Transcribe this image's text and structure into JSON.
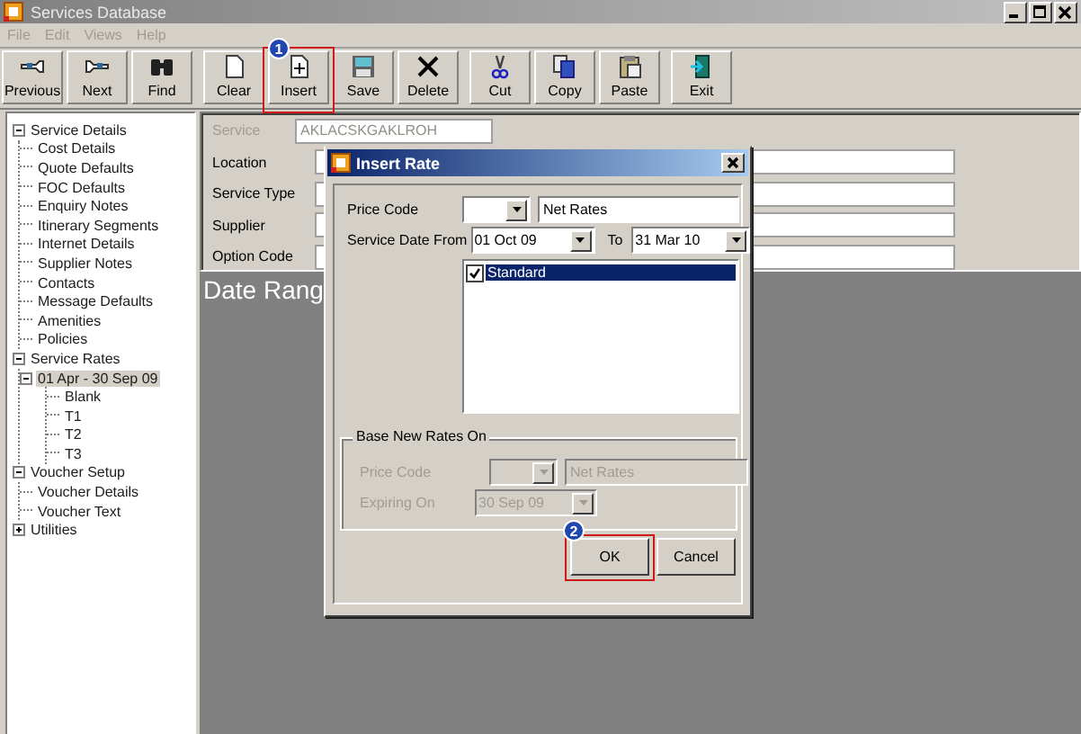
{
  "window": {
    "title": "Services Database"
  },
  "menu": [
    {
      "label": "File",
      "disabled": true
    },
    {
      "label": "Edit",
      "disabled": true
    },
    {
      "label": "Views",
      "disabled": true
    },
    {
      "label": "Help",
      "disabled": true
    }
  ],
  "toolbar": [
    [
      {
        "label": "Previous",
        "kind": "previous"
      },
      {
        "label": "Next",
        "kind": "next"
      },
      {
        "label": "Find",
        "kind": "find"
      }
    ],
    [
      {
        "label": "Clear",
        "kind": "clear"
      },
      {
        "label": "Insert",
        "kind": "insert",
        "annotation": "1"
      },
      {
        "label": "Save",
        "kind": "save"
      },
      {
        "label": "Delete",
        "kind": "delete"
      }
    ],
    [
      {
        "label": "Cut",
        "kind": "cut"
      },
      {
        "label": "Copy",
        "kind": "copy"
      },
      {
        "label": "Paste",
        "kind": "paste"
      }
    ]
  ],
  "toolbar_right": [
    {
      "label": "Exit",
      "kind": "exit"
    }
  ],
  "tree": [
    {
      "label": "Service Details",
      "expanded": true,
      "selected": false,
      "children": [
        {
          "label": "Cost Details",
          "selected": false
        },
        {
          "label": "Quote Defaults",
          "selected": false
        },
        {
          "label": "FOC Defaults",
          "selected": false
        },
        {
          "label": "Enquiry Notes",
          "selected": false
        },
        {
          "label": "Itinerary Segments",
          "selected": false
        },
        {
          "label": "Internet Details",
          "selected": false
        },
        {
          "label": "Supplier Notes",
          "selected": false
        },
        {
          "label": "Contacts",
          "selected": false
        },
        {
          "label": "Message Defaults",
          "selected": false
        },
        {
          "label": "Amenities",
          "selected": false
        },
        {
          "label": "Policies",
          "selected": false
        }
      ]
    },
    {
      "label": "Service Rates",
      "expanded": true,
      "selected": false,
      "children": [
        {
          "label": "01 Apr - 30 Sep 09",
          "expanded": true,
          "selected": true,
          "children": [
            {
              "label": "Blank",
              "selected": false
            },
            {
              "label": "T1",
              "selected": false
            },
            {
              "label": "T2",
              "selected": false
            },
            {
              "label": "T3",
              "selected": false
            }
          ]
        }
      ]
    },
    {
      "label": "Voucher Setup",
      "expanded": true,
      "selected": false,
      "children": [
        {
          "label": "Voucher Details",
          "selected": false
        },
        {
          "label": "Voucher Text",
          "selected": false
        }
      ]
    },
    {
      "label": "Utilities",
      "expanded": false,
      "selected": false
    }
  ],
  "form": {
    "fields": [
      {
        "label": "Service",
        "value": "AKLACSKGAKLROH",
        "disabled": true
      },
      {
        "label": "Location",
        "disabled": false
      },
      {
        "label": "Service Type",
        "disabled": false
      },
      {
        "label": "Supplier",
        "disabled": false
      },
      {
        "label": "Option Code",
        "disabled": false
      }
    ]
  },
  "date_range_heading": "Date Rang",
  "dialog": {
    "title": "Insert Rate",
    "price_code": {
      "label": "Price Code",
      "name": "Net Rates"
    },
    "date_from": {
      "label": "Service Date From",
      "value": "01 Oct 09"
    },
    "date_to": {
      "label": "To",
      "value": "31 Mar 10"
    },
    "list": [
      {
        "label": "Standard",
        "checked": true,
        "selected": true
      }
    ],
    "base_group": {
      "title": "Base New Rates On",
      "disabled": true,
      "price_code": {
        "label": "Price Code",
        "name": "Net Rates"
      },
      "expiring_on": {
        "label": "Expiring On",
        "value": "30 Sep 09"
      }
    },
    "buttons": [
      {
        "label": "OK",
        "annotation": "2"
      },
      {
        "label": "Cancel"
      }
    ]
  }
}
